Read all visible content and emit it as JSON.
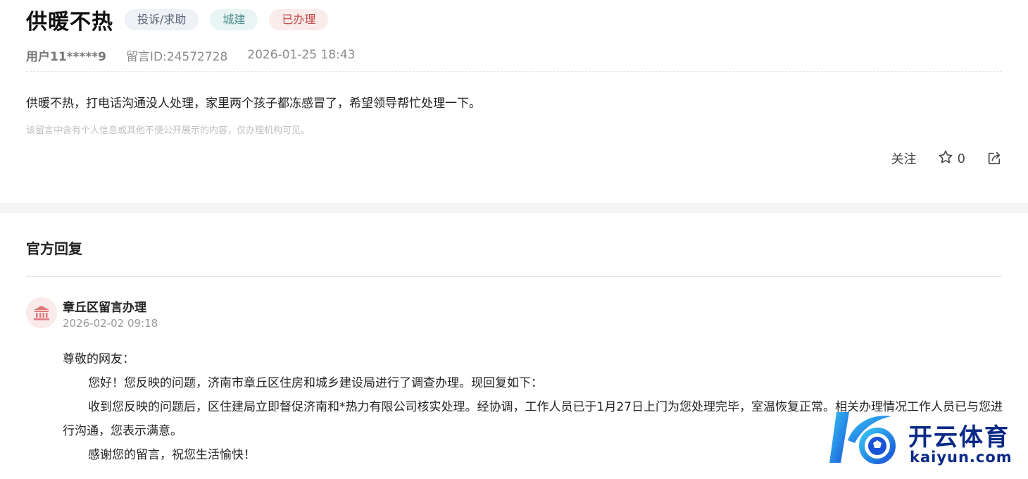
{
  "post": {
    "title": "供暖不热",
    "tags": {
      "type": "投诉/求助",
      "category": "城建",
      "status": "已办理"
    },
    "user": "用户11*****9",
    "message_id": "留言ID:24572728",
    "datetime": "2026-01-25 18:43",
    "content": "供暖不热，打电话沟通没人处理，家里两个孩子都冻感冒了，希望领导帮忙处理一下。",
    "privacy_notice": "该留言中含有个人信息或其他不便公开展示的内容，仅办理机构可见。",
    "actions": {
      "follow_label": "关注",
      "favorite_count": "0"
    }
  },
  "reply": {
    "section_title": "官方回复",
    "department": "章丘区留言办理",
    "datetime": "2026-02-02 09:18",
    "greeting": "尊敬的网友：",
    "paragraphs": [
      "您好！您反映的问题，济南市章丘区住房和城乡建设局进行了调查办理。现回复如下：",
      "收到您反映的问题后，区住建局立即督促济南和*热力有限公司核实处理。经协调，工作人员已于1月27日上门为您处理完毕，室温恢复正常。相关办理情况工作人员已与您进行沟通，您表示满意。",
      "感谢您的留言，祝您生活愉快！"
    ]
  },
  "watermark": {
    "name_cn": "开云体育",
    "name_en": "kaiyun.com"
  },
  "colors": {
    "status_red": "#c84a4a",
    "category_teal": "#4d8f8c",
    "brand_blue": "#0a2a86"
  },
  "icons": [
    "star-icon",
    "share-icon",
    "government-building-icon",
    "kaiyun-logo-icon"
  ]
}
